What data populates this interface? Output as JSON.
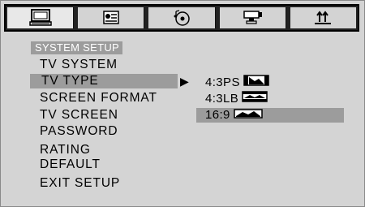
{
  "tabs": [
    {
      "icon": "monitor-icon",
      "active": true
    },
    {
      "icon": "speaker-language-icon",
      "active": false
    },
    {
      "icon": "disc-audio-icon",
      "active": false
    },
    {
      "icon": "video-camera-icon",
      "active": false
    },
    {
      "icon": "preference-arrows-icon",
      "active": false
    }
  ],
  "menu": {
    "title": "SYSTEM SETUP",
    "items": [
      {
        "label": "TV SYSTEM"
      },
      {
        "label": "TV TYPE",
        "selected": true
      },
      {
        "label": "SCREEN FORMAT"
      },
      {
        "label": "TV SCREEN"
      },
      {
        "label": "PASSWORD"
      },
      {
        "label": "RATING"
      },
      {
        "label": "DEFAULT"
      },
      {
        "label": "EXIT SETUP"
      }
    ],
    "pointer": "▶"
  },
  "options": [
    {
      "label": "4:3PS",
      "icon": "aspect-4-3-ps-icon"
    },
    {
      "label": "4:3LB",
      "icon": "aspect-4-3-lb-icon"
    },
    {
      "label": "16:9",
      "icon": "aspect-16-9-icon",
      "highlighted": true
    }
  ],
  "colors": {
    "background": "#d4d4d4",
    "highlight": "#9c9c9c",
    "tab_border": "#222222"
  }
}
